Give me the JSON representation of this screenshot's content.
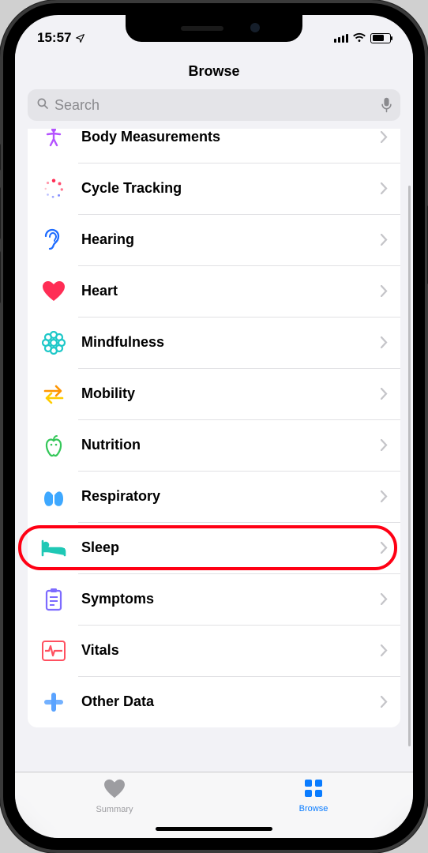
{
  "status": {
    "time": "15:57",
    "location_arrow": true
  },
  "nav": {
    "title": "Browse"
  },
  "search": {
    "placeholder": "Search"
  },
  "categories": [
    {
      "id": "body-measurements",
      "label": "Body Measurements",
      "icon": "person-arms-icon",
      "color": "#b452ff"
    },
    {
      "id": "cycle-tracking",
      "label": "Cycle Tracking",
      "icon": "cycle-dots-icon",
      "color": "#ff3b6f"
    },
    {
      "id": "hearing",
      "label": "Hearing",
      "icon": "ear-icon",
      "color": "#1e6cff"
    },
    {
      "id": "heart",
      "label": "Heart",
      "icon": "heart-icon",
      "color": "#ff2d55"
    },
    {
      "id": "mindfulness",
      "label": "Mindfulness",
      "icon": "flower-icon",
      "color": "#1ec8c8"
    },
    {
      "id": "mobility",
      "label": "Mobility",
      "icon": "arrows-icon",
      "color": "#ff9500"
    },
    {
      "id": "nutrition",
      "label": "Nutrition",
      "icon": "apple-icon",
      "color": "#34c759"
    },
    {
      "id": "respiratory",
      "label": "Respiratory",
      "icon": "lungs-icon",
      "color": "#3ea8ff"
    },
    {
      "id": "sleep",
      "label": "Sleep",
      "icon": "bed-icon",
      "color": "#1fc8b5",
      "highlighted": true
    },
    {
      "id": "symptoms",
      "label": "Symptoms",
      "icon": "clipboard-icon",
      "color": "#7d6bff"
    },
    {
      "id": "vitals",
      "label": "Vitals",
      "icon": "ecg-icon",
      "color": "#ff5060"
    },
    {
      "id": "other-data",
      "label": "Other Data",
      "icon": "plus-icon",
      "color": "#5aa3ff"
    }
  ],
  "tabs": {
    "summary": {
      "label": "Summary",
      "active": false
    },
    "browse": {
      "label": "Browse",
      "active": true
    }
  }
}
